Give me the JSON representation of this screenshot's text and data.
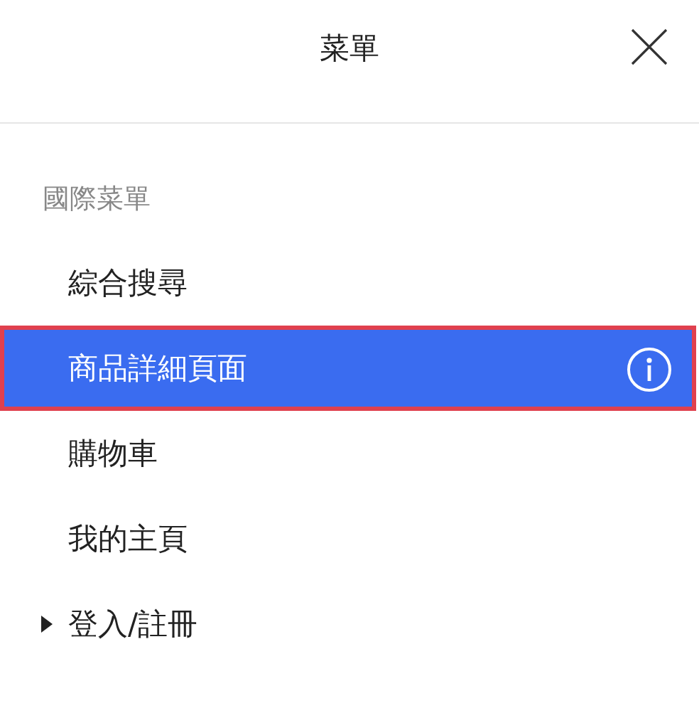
{
  "header": {
    "title": "菜單"
  },
  "section": {
    "label": "國際菜單",
    "items": [
      {
        "label": "綜合搜尋",
        "selected": false,
        "info": false,
        "expandable": false
      },
      {
        "label": "商品詳細頁面",
        "selected": true,
        "info": true,
        "expandable": false
      },
      {
        "label": "購物車",
        "selected": false,
        "info": false,
        "expandable": false
      },
      {
        "label": "我的主頁",
        "selected": false,
        "info": false,
        "expandable": false
      },
      {
        "label": "登入/註冊",
        "selected": false,
        "info": false,
        "expandable": true
      }
    ]
  }
}
